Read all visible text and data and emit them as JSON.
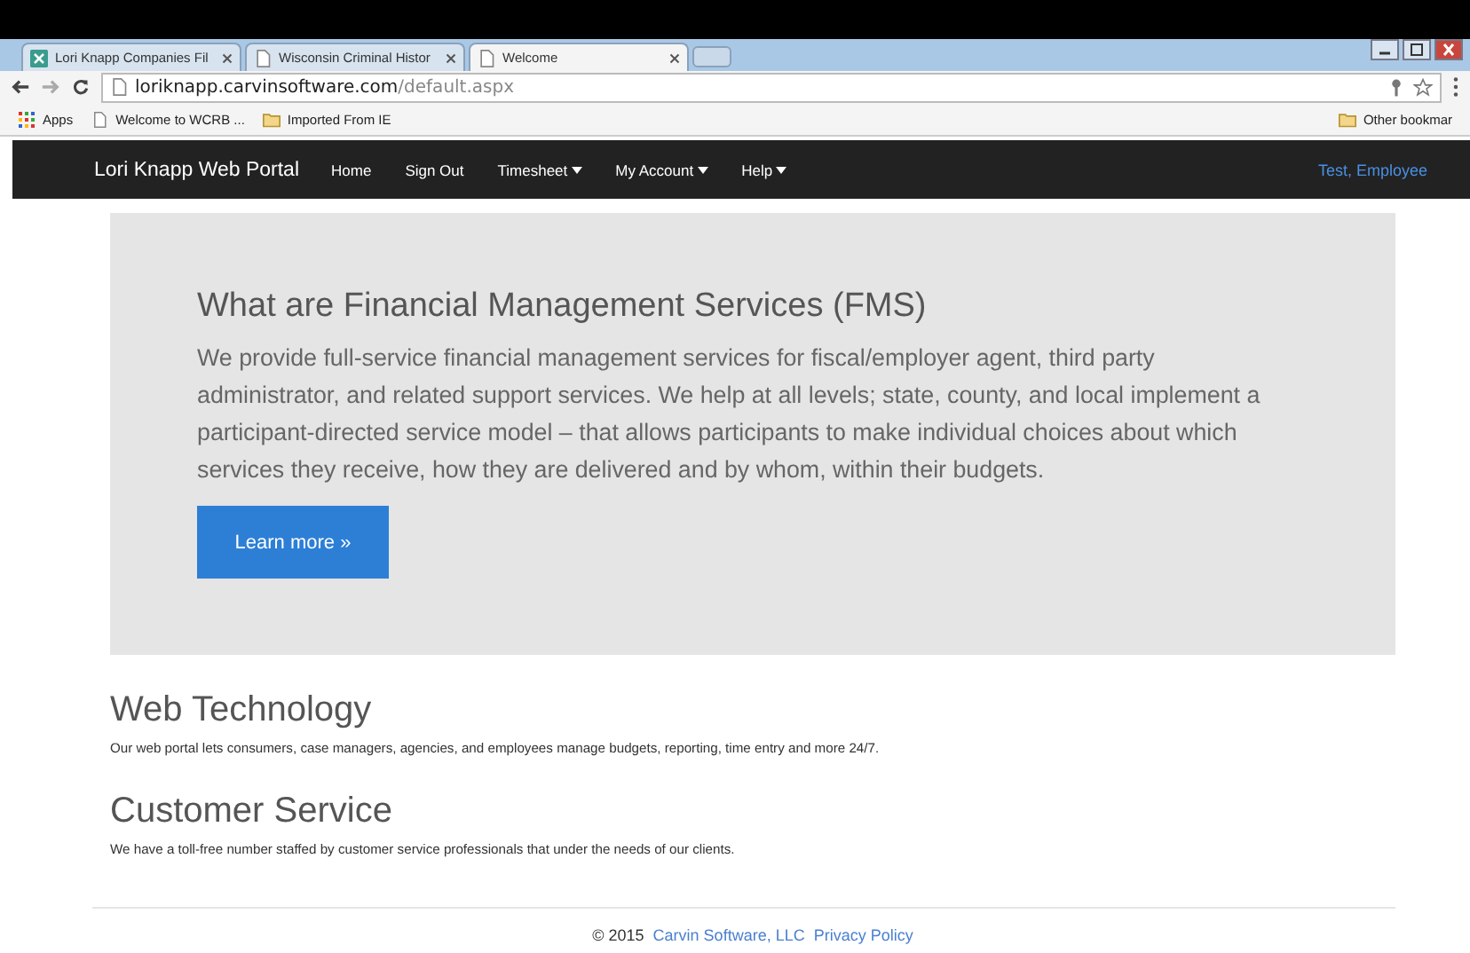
{
  "browser": {
    "tabs": [
      {
        "title": "Lori Knapp Companies Fil",
        "selected": false,
        "kind": "site"
      },
      {
        "title": "Wisconsin Criminal Histor",
        "selected": false,
        "kind": "page"
      },
      {
        "title": "Welcome",
        "selected": true,
        "kind": "page"
      }
    ],
    "address": {
      "host": "loriknapp.carvinsoftware.com",
      "path": "/default.aspx"
    },
    "bookmarks": [
      {
        "label": "Apps",
        "kind": "apps"
      },
      {
        "label": "Welcome to WCRB ...",
        "kind": "page"
      },
      {
        "label": "Imported From IE",
        "kind": "folder"
      }
    ],
    "other_bookmarks": "Other bookmar"
  },
  "navbar": {
    "brand": "Lori Knapp Web Portal",
    "items": [
      {
        "label": "Home",
        "dropdown": false
      },
      {
        "label": "Sign Out",
        "dropdown": false
      },
      {
        "label": "Timesheet",
        "dropdown": true
      },
      {
        "label": "My Account",
        "dropdown": true
      },
      {
        "label": "Help",
        "dropdown": true
      }
    ],
    "user": "Test, Employee"
  },
  "hero": {
    "title": "What are Financial Management Services (FMS)",
    "text": "We provide full-service financial management services for fiscal/employer agent, third party administrator, and related support services. We help at all levels; state, county, and local implement a participant-directed service model – that allows participants to make individual choices about which services they receive, how they are delivered and by whom, within their budgets.",
    "button": "Learn more »"
  },
  "sections": [
    {
      "heading": "Web Technology",
      "text": "Our web portal lets consumers, case managers, agencies, and employees manage budgets, reporting, time entry and more 24/7."
    },
    {
      "heading": "Customer Service",
      "text": "We have a toll-free number staffed by customer service professionals that under the needs of our clients."
    }
  ],
  "footer": {
    "copyright": "© 2015",
    "company": "Carvin Software, LLC",
    "privacy": "Privacy Policy"
  }
}
